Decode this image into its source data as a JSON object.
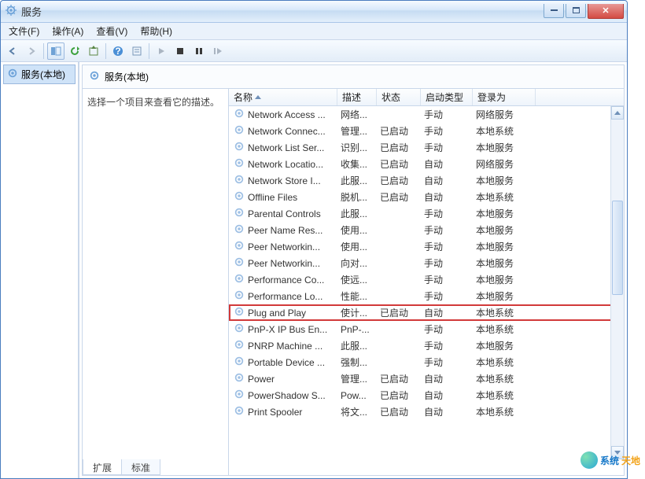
{
  "window": {
    "title": "服务"
  },
  "menu": {
    "file": "文件(F)",
    "action": "操作(A)",
    "view": "查看(V)",
    "help": "帮助(H)"
  },
  "left": {
    "node": "服务(本地)"
  },
  "header": {
    "title": "服务(本地)"
  },
  "desc_panel": {
    "hint": "选择一个项目来查看它的描述。"
  },
  "columns": {
    "name": "名称",
    "desc": "描述",
    "status": "状态",
    "startup": "启动类型",
    "logon": "登录为"
  },
  "tabs": {
    "extended": "扩展",
    "standard": "标准"
  },
  "watermark": {
    "t1": "系统",
    "t2": "天地"
  },
  "rows": [
    {
      "name": "Network Access ...",
      "desc": "网络...",
      "status": "",
      "startup": "手动",
      "logon": "网络服务"
    },
    {
      "name": "Network Connec...",
      "desc": "管理...",
      "status": "已启动",
      "startup": "手动",
      "logon": "本地系统"
    },
    {
      "name": "Network List Ser...",
      "desc": "识别...",
      "status": "已启动",
      "startup": "手动",
      "logon": "本地服务"
    },
    {
      "name": "Network Locatio...",
      "desc": "收集...",
      "status": "已启动",
      "startup": "自动",
      "logon": "网络服务"
    },
    {
      "name": "Network Store I...",
      "desc": "此服...",
      "status": "已启动",
      "startup": "自动",
      "logon": "本地服务"
    },
    {
      "name": "Offline Files",
      "desc": "脱机...",
      "status": "已启动",
      "startup": "自动",
      "logon": "本地系统"
    },
    {
      "name": "Parental Controls",
      "desc": "此服...",
      "status": "",
      "startup": "手动",
      "logon": "本地服务"
    },
    {
      "name": "Peer Name Res...",
      "desc": "使用...",
      "status": "",
      "startup": "手动",
      "logon": "本地服务"
    },
    {
      "name": "Peer Networkin...",
      "desc": "使用...",
      "status": "",
      "startup": "手动",
      "logon": "本地服务"
    },
    {
      "name": "Peer Networkin...",
      "desc": "向对...",
      "status": "",
      "startup": "手动",
      "logon": "本地服务"
    },
    {
      "name": "Performance Co...",
      "desc": "使远...",
      "status": "",
      "startup": "手动",
      "logon": "本地服务"
    },
    {
      "name": "Performance Lo...",
      "desc": "性能...",
      "status": "",
      "startup": "手动",
      "logon": "本地服务"
    },
    {
      "name": "Plug and Play",
      "desc": "使计...",
      "status": "已启动",
      "startup": "自动",
      "logon": "本地系统"
    },
    {
      "name": "PnP-X IP Bus En...",
      "desc": "PnP-...",
      "status": "",
      "startup": "手动",
      "logon": "本地系统"
    },
    {
      "name": "PNRP Machine ...",
      "desc": "此服...",
      "status": "",
      "startup": "手动",
      "logon": "本地服务"
    },
    {
      "name": "Portable Device ...",
      "desc": "强制...",
      "status": "",
      "startup": "手动",
      "logon": "本地系统"
    },
    {
      "name": "Power",
      "desc": "管理...",
      "status": "已启动",
      "startup": "自动",
      "logon": "本地系统"
    },
    {
      "name": "PowerShadow S...",
      "desc": "Pow...",
      "status": "已启动",
      "startup": "自动",
      "logon": "本地系统"
    },
    {
      "name": "Print Spooler",
      "desc": "将文...",
      "status": "已启动",
      "startup": "自动",
      "logon": "本地系统"
    }
  ],
  "highlight_index": 12
}
